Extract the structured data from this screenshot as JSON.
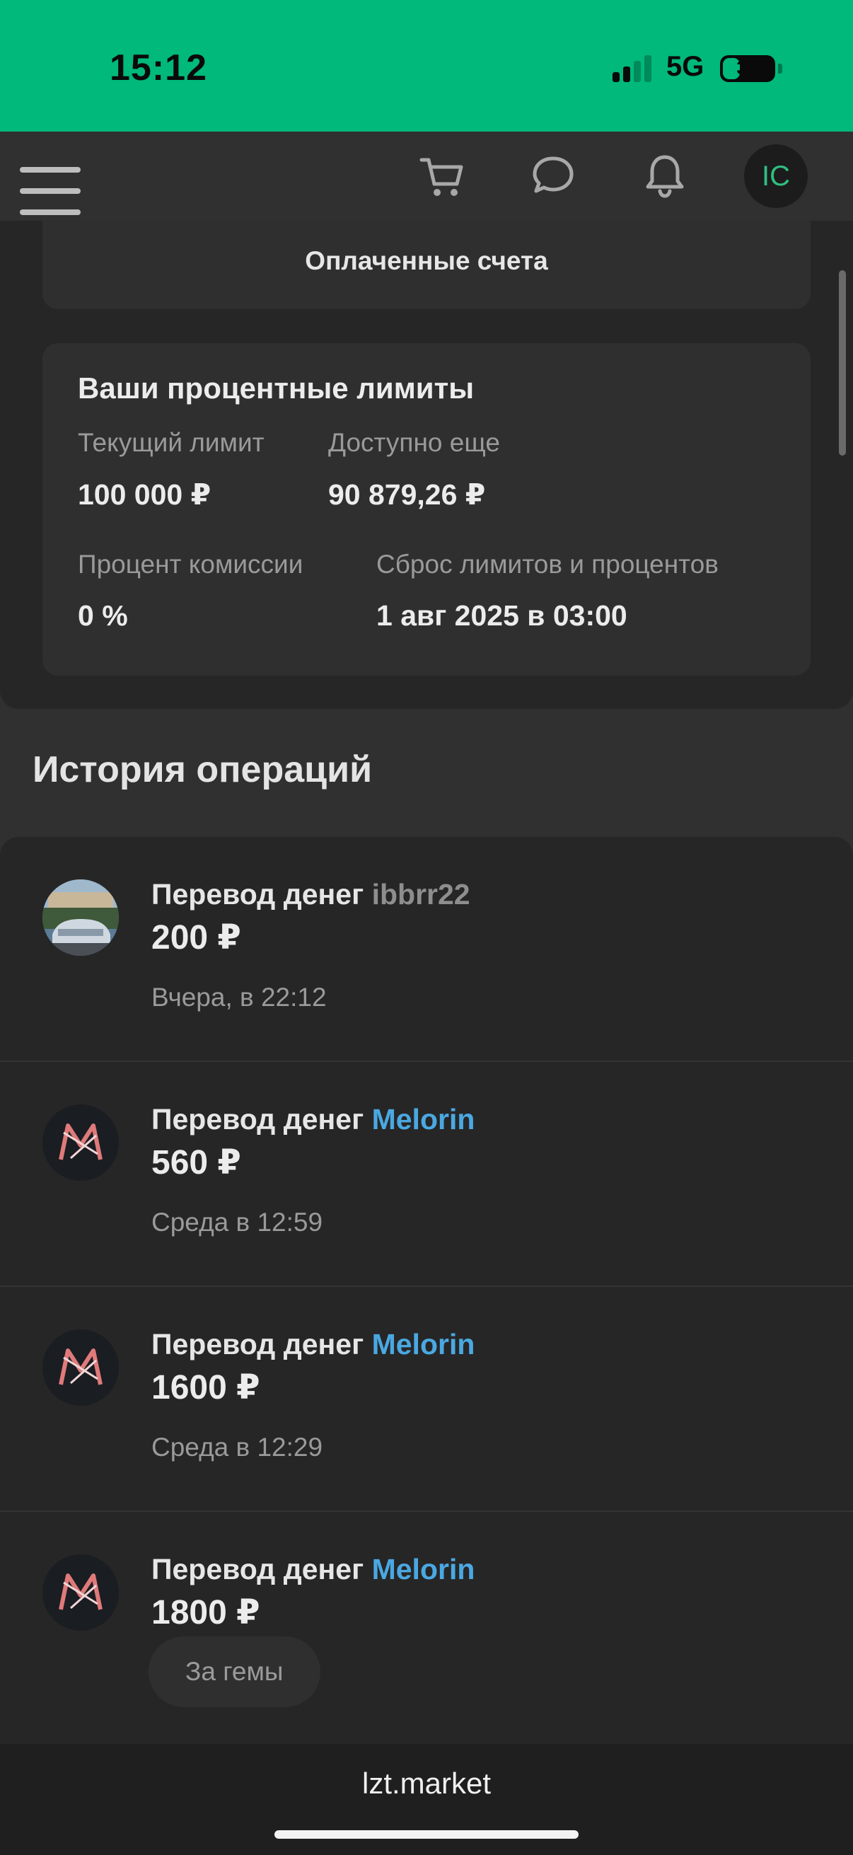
{
  "status_bar": {
    "time": "15:12",
    "network": "5G",
    "battery_percent": "30",
    "signal_bars_active": 2,
    "colors": {
      "background": "#00b97a"
    }
  },
  "header": {
    "icons": [
      "menu-icon",
      "cart-icon",
      "chat-icon",
      "bell-icon"
    ],
    "avatar_initials": "IC"
  },
  "top_panel": {
    "paid_bills_label": "Оплаченные счета",
    "limits": {
      "title": "Ваши процентные лимиты",
      "current_limit_label": "Текущий лимит",
      "current_limit_value": "100 000 ₽",
      "available_label": "Доступно еще",
      "available_value": "90 879,26 ₽",
      "commission_label": "Процент комиссии",
      "commission_value": "0 %",
      "reset_label": "Сброс лимитов и процентов",
      "reset_value": "1 авг 2025 в 03:00"
    }
  },
  "history": {
    "title": "История операций",
    "operations": [
      {
        "title": "Перевод денег",
        "user": "ibbrr22",
        "user_color": "gray",
        "amount": "200 ₽",
        "time": "Вчера, в 22:12",
        "avatar": "car-photo"
      },
      {
        "title": "Перевод денег",
        "user": "Melorin",
        "user_color": "blue",
        "amount": "560 ₽",
        "time": "Среда в 12:59",
        "avatar": "m-logo"
      },
      {
        "title": "Перевод денег",
        "user": "Melorin",
        "user_color": "blue",
        "amount": "1600 ₽",
        "time": "Среда в 12:29",
        "avatar": "m-logo"
      },
      {
        "title": "Перевод денег",
        "user": "Melorin",
        "user_color": "blue",
        "amount": "1800 ₽",
        "comment": "За гемы",
        "avatar": "m-logo"
      }
    ]
  },
  "browser": {
    "url": "lzt.market"
  }
}
